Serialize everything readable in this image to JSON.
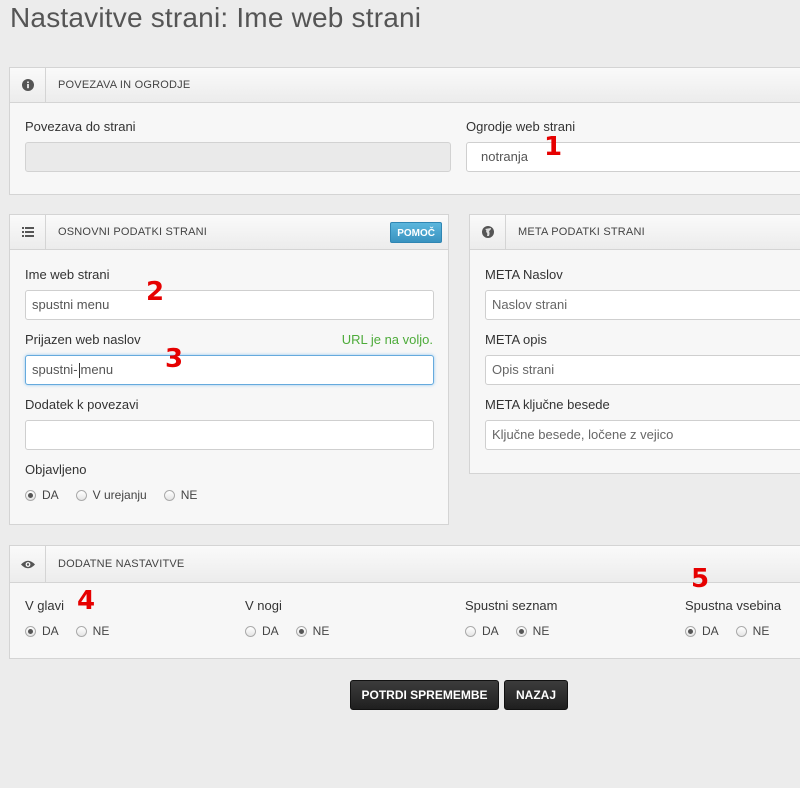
{
  "page": {
    "title": "Nastavitve strani: Ime web strani"
  },
  "link_panel": {
    "title": "POVEZAVA IN OGRODJE",
    "icon": "info-icon",
    "link_label": "Povezava do strani",
    "link_value": "",
    "frame_label": "Ogrodje web strani",
    "frame_value": "notranja"
  },
  "basic_panel": {
    "title": "OSNOVNI PODATKI STRANI",
    "icon": "list-icon",
    "help_label": "POMOČ",
    "name_label": "Ime web strani",
    "name_value": "spustni menu",
    "url_label": "Prijazen web naslov",
    "url_hint": "URL je na voljo.",
    "url_value_before_caret": "spustni-",
    "url_value_after_caret": "menu",
    "suffix_label": "Dodatek k povezavi",
    "suffix_value": "",
    "published_label": "Objavljeno",
    "published_options": [
      "DA",
      "V urejanju",
      "NE"
    ],
    "published_selected": "DA"
  },
  "meta_panel": {
    "title": "META PODATKI STRANI",
    "icon": "globe-icon",
    "meta_title_label": "META Naslov",
    "meta_title_placeholder": "Naslov strani",
    "meta_desc_label": "META opis",
    "meta_desc_placeholder": "Opis strani",
    "meta_keywords_label": "META ključne besede",
    "meta_keywords_placeholder": "Ključne besede, ločene z vejico"
  },
  "extra_panel": {
    "title": "DODATNE NASTAVITVE",
    "icon": "eye-icon",
    "groups": [
      {
        "label": "V glavi",
        "options": [
          "DA",
          "NE"
        ],
        "selected": "DA"
      },
      {
        "label": "V nogi",
        "options": [
          "DA",
          "NE"
        ],
        "selected": "NE"
      },
      {
        "label": "Spustni seznam",
        "options": [
          "DA",
          "NE"
        ],
        "selected": "NE"
      },
      {
        "label": "Spustna vsebina",
        "options": [
          "DA",
          "NE"
        ],
        "selected": "DA"
      }
    ]
  },
  "actions": {
    "confirm_label": "POTRDI SPREMEMBE",
    "back_label": "NAZAJ"
  },
  "annotations": [
    "1",
    "2",
    "3",
    "4",
    "5"
  ],
  "colors": {
    "accent_help": "#3a93c0",
    "hint_green": "#4dab3a",
    "annotation_red": "#e60000"
  }
}
